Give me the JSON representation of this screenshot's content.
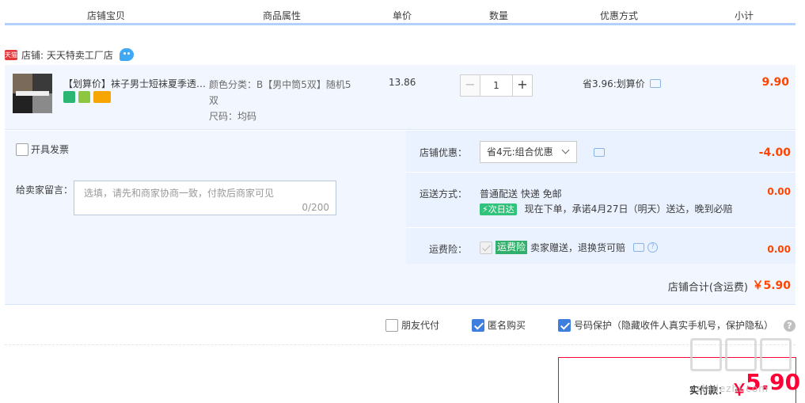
{
  "header": {
    "col_item": "店铺宝贝",
    "col_attr": "商品属性",
    "col_price": "单价",
    "col_qty": "数量",
    "col_discount": "优惠方式",
    "col_subtotal": "小计"
  },
  "shop": {
    "badge": "天猫",
    "name": "店铺: 天天特卖工厂店"
  },
  "item": {
    "title": "【划算价】袜子男士短袜夏季透气薄款",
    "attr_color": "颜色分类：B【男中筒5双】随机5双",
    "attr_size": "尺码：均码",
    "unit_price": "13.86",
    "quantity": "1",
    "qty_minus": "−",
    "qty_plus": "+",
    "discount": "省3.96:划算价",
    "subtotal": "9.90"
  },
  "options": {
    "invoice": "开具发票",
    "message_label": "给卖家留言：",
    "message_placeholder": "选填，请先和商家协商一致，付款后商家可见",
    "message_count": "0/200"
  },
  "shop_discount": {
    "label": "店铺优惠：",
    "selected": "省4元:组合优惠",
    "amount": "-4.00"
  },
  "shipping": {
    "label": "运送方式：",
    "method": "普通配送 快递 免邮",
    "badge": "次日达",
    "promise": "现在下单，承诺4月27日（明天）送达，晚到必赔",
    "amount": "0.00"
  },
  "insurance": {
    "label": "运费险：",
    "badge": "运费险",
    "desc": "卖家赠送，退换货可赔",
    "amount": "0.00"
  },
  "shop_total": {
    "label": "店铺合计(含运费)",
    "value": "￥5.90"
  },
  "bottom_options": {
    "friend_pay": "朋友代付",
    "anonymous": "匿名购买",
    "number_protect": "号码保护（隐藏收件人真实手机号，保护隐私）"
  },
  "payment": {
    "label": "实付款：",
    "currency": "￥",
    "amount": "5.90"
  },
  "watermark": "zhidezhi.com",
  "colors": {
    "price_red": "#ff4400",
    "accent_blue": "#3d7ede",
    "panel_bg": "#f2f7ff"
  }
}
